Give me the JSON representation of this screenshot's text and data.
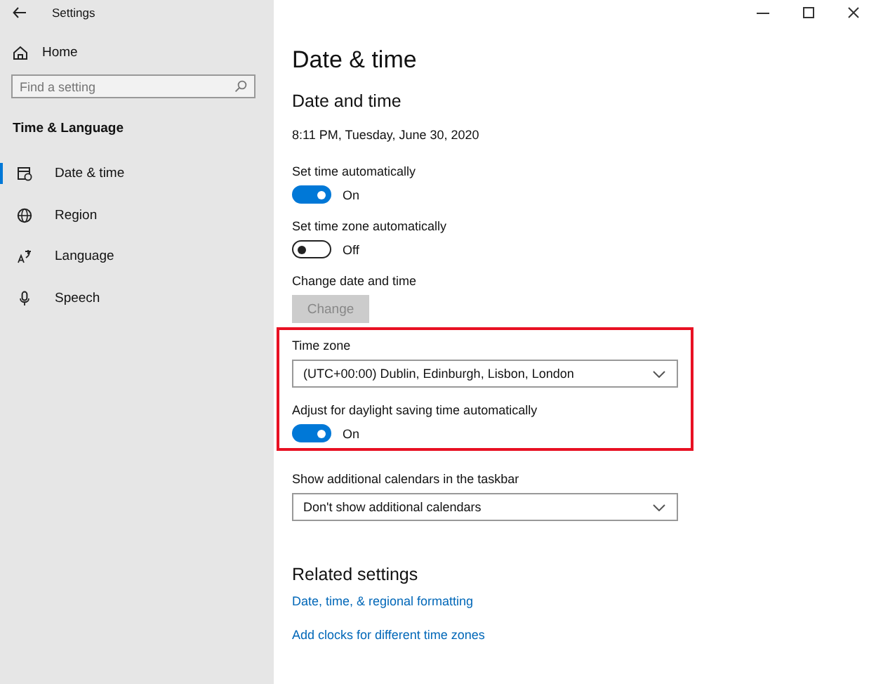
{
  "window": {
    "title": "Settings"
  },
  "sidebar": {
    "home": "Home",
    "search": {
      "placeholder": "Find a setting"
    },
    "section": "Time & Language",
    "items": [
      {
        "label": "Date & time",
        "selected": true,
        "kind": "calendar"
      },
      {
        "label": "Region",
        "selected": false,
        "kind": "globe"
      },
      {
        "label": "Language",
        "selected": false,
        "kind": "language"
      },
      {
        "label": "Speech",
        "selected": false,
        "kind": "microphone"
      }
    ]
  },
  "page": {
    "title": "Date & time",
    "section_title": "Date and time",
    "current_time": "8:11 PM, Tuesday, June 30, 2020",
    "groups": [
      {
        "highlighted": false,
        "settings": [
          {
            "kind": "toggle",
            "label": "Set time automatically",
            "on": true,
            "state_text": "On"
          },
          {
            "kind": "toggle",
            "label": "Set time zone automatically",
            "on": false,
            "state_text": "Off"
          },
          {
            "kind": "button",
            "label": "Change date and time",
            "button": "Change",
            "disabled": true
          }
        ]
      },
      {
        "highlighted": true,
        "settings": [
          {
            "kind": "dropdown",
            "label": "Time zone",
            "value": "(UTC+00:00) Dublin, Edinburgh, Lisbon, London"
          },
          {
            "kind": "toggle",
            "label": "Adjust for daylight saving time automatically",
            "on": true,
            "state_text": "On"
          }
        ]
      },
      {
        "highlighted": false,
        "settings": [
          {
            "kind": "dropdown",
            "label": "Show additional calendars in the taskbar",
            "value": "Don't show additional calendars"
          }
        ]
      }
    ]
  },
  "related": {
    "title": "Related settings",
    "links": [
      "Date, time, & regional formatting",
      "Add clocks for different time zones"
    ]
  }
}
